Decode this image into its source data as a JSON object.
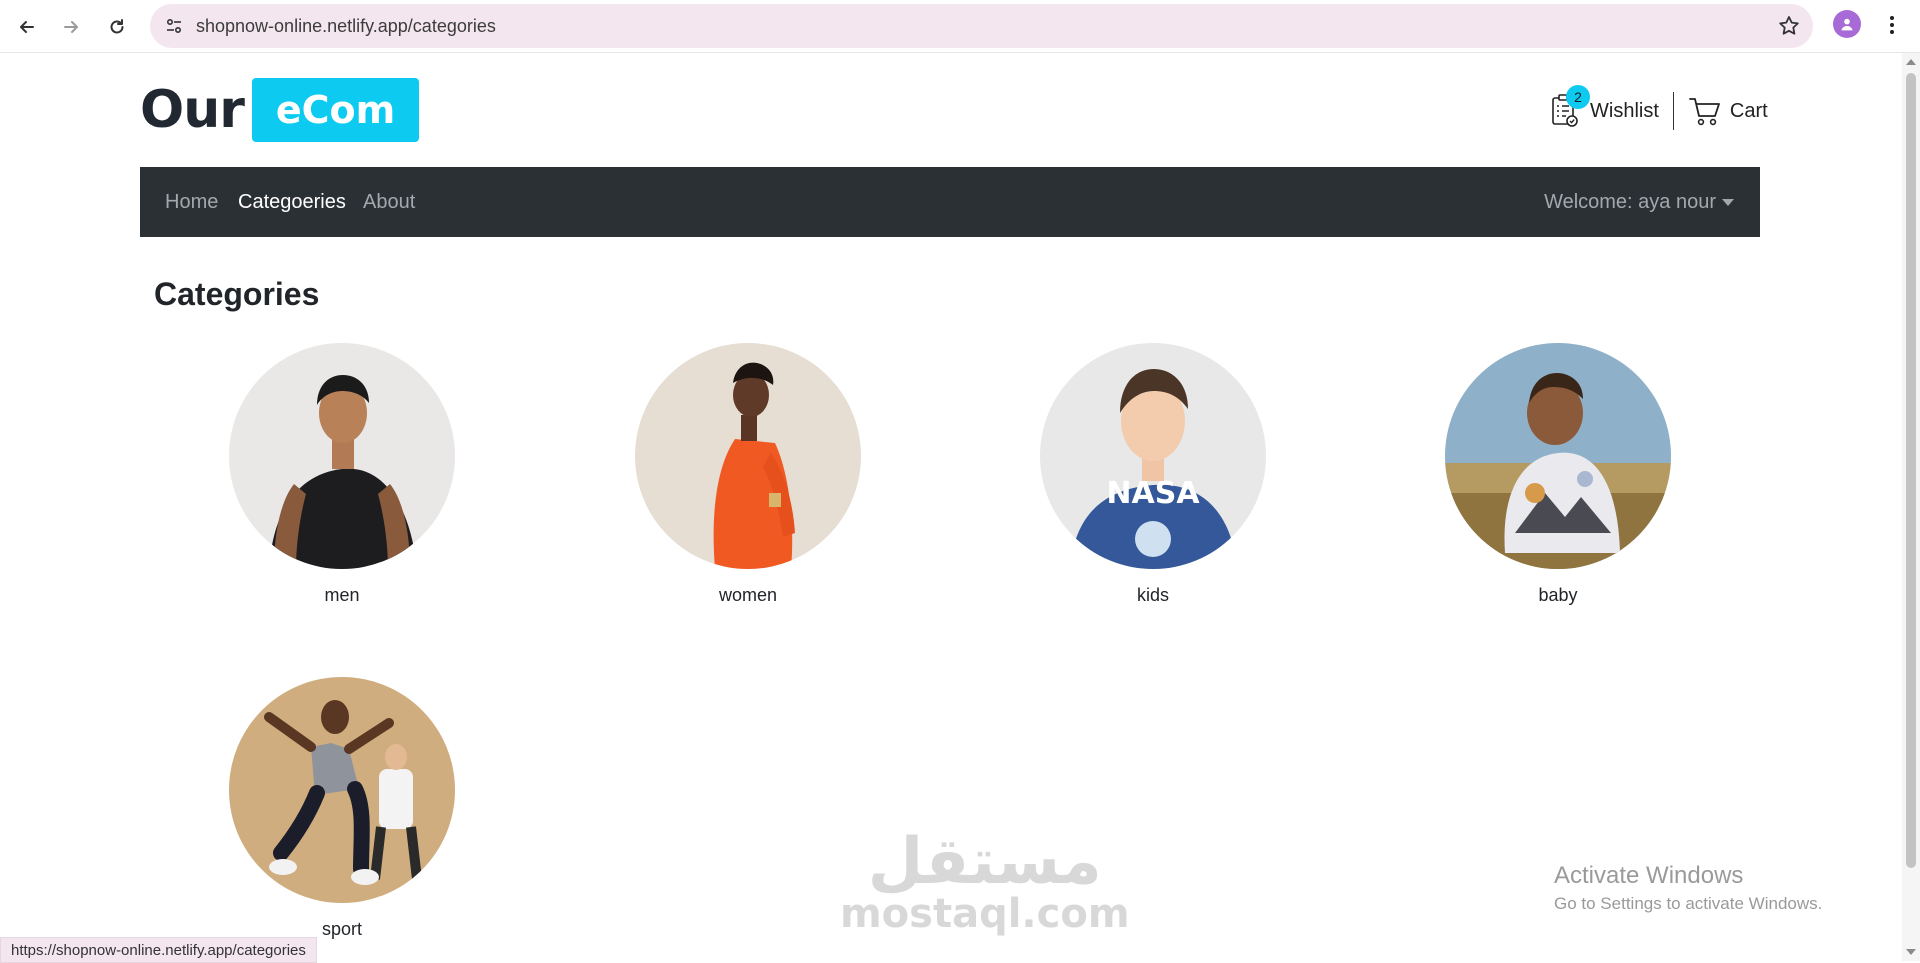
{
  "browser": {
    "url": "shopnow-online.netlify.app/categories",
    "status_url": "https://shopnow-online.netlify.app/categories"
  },
  "header": {
    "brand_our": "Our",
    "brand_ecom": "eCom",
    "wishlist_label": "Wishlist",
    "wishlist_count": "2",
    "cart_label": "Cart"
  },
  "navbar": {
    "links": [
      "Home",
      "Categoeries",
      "About"
    ],
    "active": "Categoeries",
    "welcome": "Welcome: aya nour"
  },
  "page": {
    "title": "Categories",
    "categories": [
      {
        "label": "men",
        "icon": "men-category-image"
      },
      {
        "label": "women",
        "icon": "women-category-image"
      },
      {
        "label": "kids",
        "icon": "kids-category-image"
      },
      {
        "label": "baby",
        "icon": "baby-category-image"
      },
      {
        "label": "sport",
        "icon": "sport-category-image"
      }
    ]
  },
  "overlay": {
    "watermark_arabic": "مستقل",
    "watermark_latin": "mostaql.com",
    "activate_title": "Activate Windows",
    "activate_sub": "Go to Settings to activate Windows."
  },
  "colors": {
    "brand_accent": "#0dcaf0",
    "navbar_bg": "#2b3035",
    "nav_link": "#a3a8ad",
    "nav_active": "#ffffff"
  }
}
